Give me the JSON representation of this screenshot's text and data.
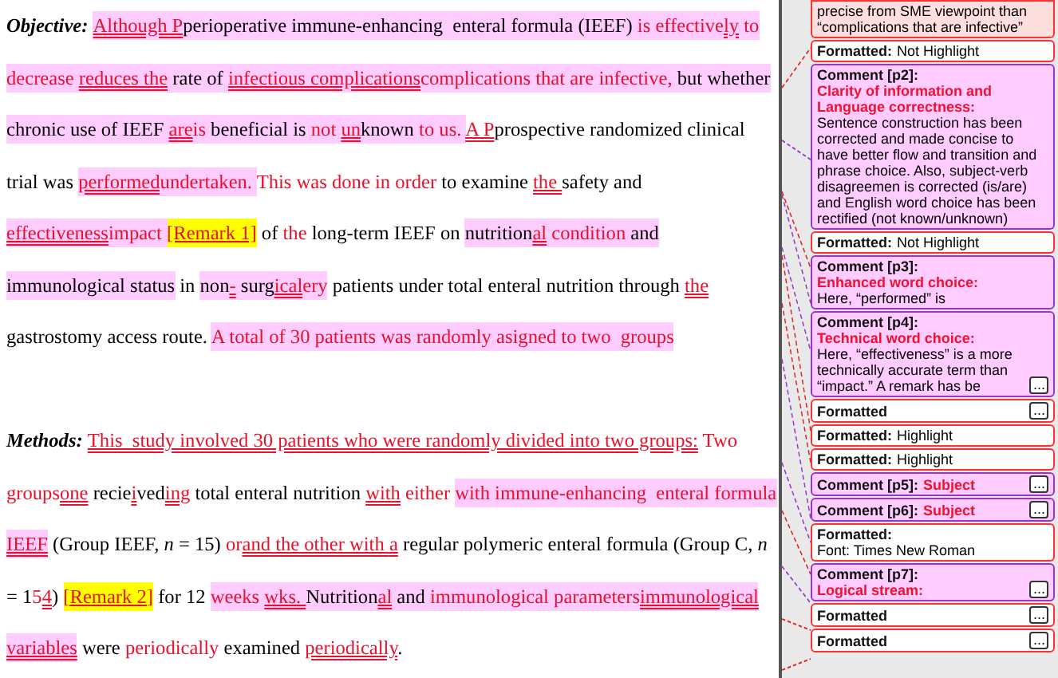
{
  "document": {
    "paragraphs": [
      {
        "lines": [
          [
            {
              "text": "Objective: ",
              "kind": "label",
              "shaded": false
            },
            {
              "text": "Although P",
              "kind": "inserted",
              "shaded": true
            },
            {
              "text": "perioperative immune-enhancing  enteral formula (IEEF) ",
              "kind": "plain",
              "shaded": true
            },
            {
              "text": "is effective",
              "kind": "changed",
              "shaded": true
            },
            {
              "text": "ly",
              "kind": "inserted",
              "shaded": true
            },
            {
              "text": " to",
              "kind": "changed",
              "shaded": true
            }
          ],
          [
            {
              "text": "decrease ",
              "kind": "changed",
              "shaded": true
            },
            {
              "text": "reduces the",
              "kind": "inserted",
              "shaded": true
            },
            {
              "text": " rate of ",
              "kind": "plain",
              "shaded": true
            },
            {
              "text": "infectious complications",
              "kind": "inserted",
              "shaded": true
            },
            {
              "text": "complications that are infective,",
              "kind": "changed",
              "shaded": true
            },
            {
              "text": " but whether",
              "kind": "plain",
              "shaded": true
            }
          ],
          [
            {
              "text": "chronic use of IEEF ",
              "kind": "plain",
              "shaded": true
            },
            {
              "text": "are",
              "kind": "inserted",
              "shaded": true
            },
            {
              "text": "is",
              "kind": "changed",
              "shaded": true
            },
            {
              "text": " beneficial is ",
              "kind": "plain",
              "shaded": true
            },
            {
              "text": "not ",
              "kind": "changed",
              "shaded": true
            },
            {
              "text": "un",
              "kind": "inserted",
              "shaded": true
            },
            {
              "text": "known",
              "kind": "plain",
              "shaded": true
            },
            {
              "text": " to us. ",
              "kind": "changed",
              "shaded": true
            },
            {
              "text": "A P",
              "kind": "inserted",
              "shaded": false
            },
            {
              "text": "prospective randomized clinical",
              "kind": "plain",
              "shaded": false
            }
          ],
          [
            {
              "text": "trial was ",
              "kind": "plain",
              "shaded": false
            },
            {
              "text": "performed",
              "kind": "inserted",
              "shaded": true
            },
            {
              "text": "undertaken. ",
              "kind": "changed",
              "shaded": true
            },
            {
              "text": "This was done in order",
              "kind": "changed",
              "shaded": false
            },
            {
              "text": " to examine ",
              "kind": "plain",
              "shaded": false
            },
            {
              "text": "the ",
              "kind": "inserted",
              "shaded": false
            },
            {
              "text": "safety and",
              "kind": "plain",
              "shaded": false
            }
          ],
          [
            {
              "text": "effectiveness",
              "kind": "inserted",
              "shaded": true
            },
            {
              "text": "impact ",
              "kind": "changed",
              "shaded": true
            },
            {
              "text": "[Remark 1]",
              "kind": "remark",
              "shaded": false
            },
            {
              "text": " of ",
              "kind": "plain",
              "shaded": false
            },
            {
              "text": "the",
              "kind": "changed",
              "shaded": false
            },
            {
              "text": " long-term IEEF on ",
              "kind": "plain",
              "shaded": false
            },
            {
              "text": "nutrition",
              "kind": "plain",
              "shaded": true
            },
            {
              "text": "al",
              "kind": "inserted",
              "shaded": true
            },
            {
              "text": " condition",
              "kind": "changed",
              "shaded": true
            },
            {
              "text": " and",
              "kind": "plain",
              "shaded": true
            }
          ],
          [
            {
              "text": "immunological status",
              "kind": "plain",
              "shaded": true
            },
            {
              "text": " in ",
              "kind": "plain",
              "shaded": false
            },
            {
              "text": "non",
              "kind": "plain",
              "shaded": true
            },
            {
              "text": "-",
              "kind": "inserted",
              "shaded": true
            },
            {
              "text": " surg",
              "kind": "plain",
              "shaded": true
            },
            {
              "text": "ical",
              "kind": "inserted",
              "shaded": true
            },
            {
              "text": "ery",
              "kind": "changed",
              "shaded": true
            },
            {
              "text": " patients under total enteral nutrition through ",
              "kind": "plain",
              "shaded": false
            },
            {
              "text": "the",
              "kind": "inserted",
              "shaded": false
            }
          ],
          [
            {
              "text": "gastrostomy access route. ",
              "kind": "plain",
              "shaded": false
            },
            {
              "text": "A total of 30 patients was randomly asigned to two  groups",
              "kind": "changed",
              "shaded": true
            }
          ]
        ]
      },
      {
        "lines": [
          [
            {
              "text": "Methods: ",
              "kind": "label",
              "shaded": false
            },
            {
              "text": "This  study involved 30 patients who were randomly divided into two groups:",
              "kind": "inserted",
              "shaded": false
            },
            {
              "text": " Two",
              "kind": "changed",
              "shaded": false
            }
          ],
          [
            {
              "text": "groups",
              "kind": "changed",
              "shaded": false
            },
            {
              "text": "one",
              "kind": "inserted",
              "shaded": false
            },
            {
              "text": " recie",
              "kind": "plain",
              "shaded": false
            },
            {
              "text": "i",
              "kind": "inserted",
              "shaded": false
            },
            {
              "text": "ved",
              "kind": "plain",
              "shaded": false
            },
            {
              "text": "ing",
              "kind": "inserted",
              "shaded": false
            },
            {
              "text": " total enteral nutrition ",
              "kind": "plain",
              "shaded": false
            },
            {
              "text": "with",
              "kind": "inserted",
              "shaded": false
            },
            {
              "text": " either ",
              "kind": "changed",
              "shaded": false
            },
            {
              "text": "with immune-enhancing  enteral formula",
              "kind": "changed",
              "shaded": true
            }
          ],
          [
            {
              "text": "IEEF",
              "kind": "inserted",
              "shaded": true
            },
            {
              "text": " (Group IEEF, *n* = 15) ",
              "kind": "plain",
              "shaded": false
            },
            {
              "text": "or",
              "kind": "changed",
              "shaded": false
            },
            {
              "text": "and the other with ",
              "kind": "inserted",
              "shaded": false
            },
            {
              "text": "a",
              "kind": "inserted",
              "shaded": false
            },
            {
              "text": " regular polymeric enteral formula (Group C, *n*",
              "kind": "plain",
              "shaded": false
            }
          ],
          [
            {
              "text": "= 1",
              "kind": "plain",
              "shaded": false
            },
            {
              "text": "5",
              "kind": "changed",
              "shaded": false
            },
            {
              "text": "4",
              "kind": "inserted",
              "shaded": false
            },
            {
              "text": ") ",
              "kind": "plain",
              "shaded": false
            },
            {
              "text": "[Remark 2]",
              "kind": "remark",
              "shaded": false
            },
            {
              "text": " for 12 ",
              "kind": "plain",
              "shaded": false
            },
            {
              "text": "weeks ",
              "kind": "changed",
              "shaded": true
            },
            {
              "text": "wks. ",
              "kind": "inserted",
              "shaded": true
            },
            {
              "text": "Nutrition",
              "kind": "plain",
              "shaded": true
            },
            {
              "text": "al",
              "kind": "inserted",
              "shaded": true
            },
            {
              "text": " and ",
              "kind": "plain",
              "shaded": true
            },
            {
              "text": "immunological parameters",
              "kind": "changed",
              "shaded": true
            },
            {
              "text": "immunological",
              "kind": "inserted",
              "shaded": true
            }
          ],
          [
            {
              "text": "variables",
              "kind": "inserted",
              "shaded": true
            },
            {
              "text": " were ",
              "kind": "plain",
              "shaded": false
            },
            {
              "text": "periodically",
              "kind": "changed",
              "shaded": false
            },
            {
              "text": " examined ",
              "kind": "plain",
              "shaded": false
            },
            {
              "text": "periodically",
              "kind": "inserted",
              "shaded": false
            },
            {
              "text": ".",
              "kind": "plain",
              "shaded": false
            }
          ]
        ]
      }
    ]
  },
  "balloons": [
    {
      "kind": "comment",
      "body": "precise from SME viewpoint than “complications that are infective”"
    },
    {
      "kind": "formatted",
      "label": "Formatted:",
      "detail": "Not Highlight"
    },
    {
      "kind": "comment",
      "label": "Comment [p2]:",
      "title": "Clarity of information and Language correctness:",
      "body": "Sentence construction has been corrected and made concise to have better flow and transition and phrase choice. Also, subject-verb disagreemen is corrected (is/are) and English word choice has been rectified (not known/unknown)"
    },
    {
      "kind": "formatted",
      "label": "Formatted:",
      "detail": "Not Highlight"
    },
    {
      "kind": "comment",
      "label": "Comment [p3]:",
      "title": "Enhanced word choice:",
      "body": "Here, “performed” is"
    },
    {
      "kind": "comment",
      "label": "Comment [p4]:",
      "title": "Technical word choice:",
      "body": "Here, “effectiveness” is a more technically accurate term than “impact.” A remark has be",
      "more": "..."
    },
    {
      "kind": "formatted",
      "label": "Formatted",
      "more": "..."
    },
    {
      "kind": "formatted",
      "label": "Formatted:",
      "detail": "Highlight"
    },
    {
      "kind": "formatted",
      "label": "Formatted:",
      "detail": "Highlight"
    },
    {
      "kind": "comment",
      "label": "Comment [p5]:",
      "title": "Subject",
      "more": "..."
    },
    {
      "kind": "comment",
      "label": "Comment [p6]:",
      "title": "Subject",
      "more": "..."
    },
    {
      "kind": "formatted",
      "label": "Formatted:",
      "detail": "Font: Times New Roman"
    },
    {
      "kind": "comment",
      "label": "Comment [p7]:",
      "title": "Logical stream:",
      "more": "..."
    },
    {
      "kind": "formatted",
      "label": "Formatted",
      "more": "..."
    },
    {
      "kind": "formatted",
      "label": "Formatted",
      "more": "..."
    }
  ]
}
